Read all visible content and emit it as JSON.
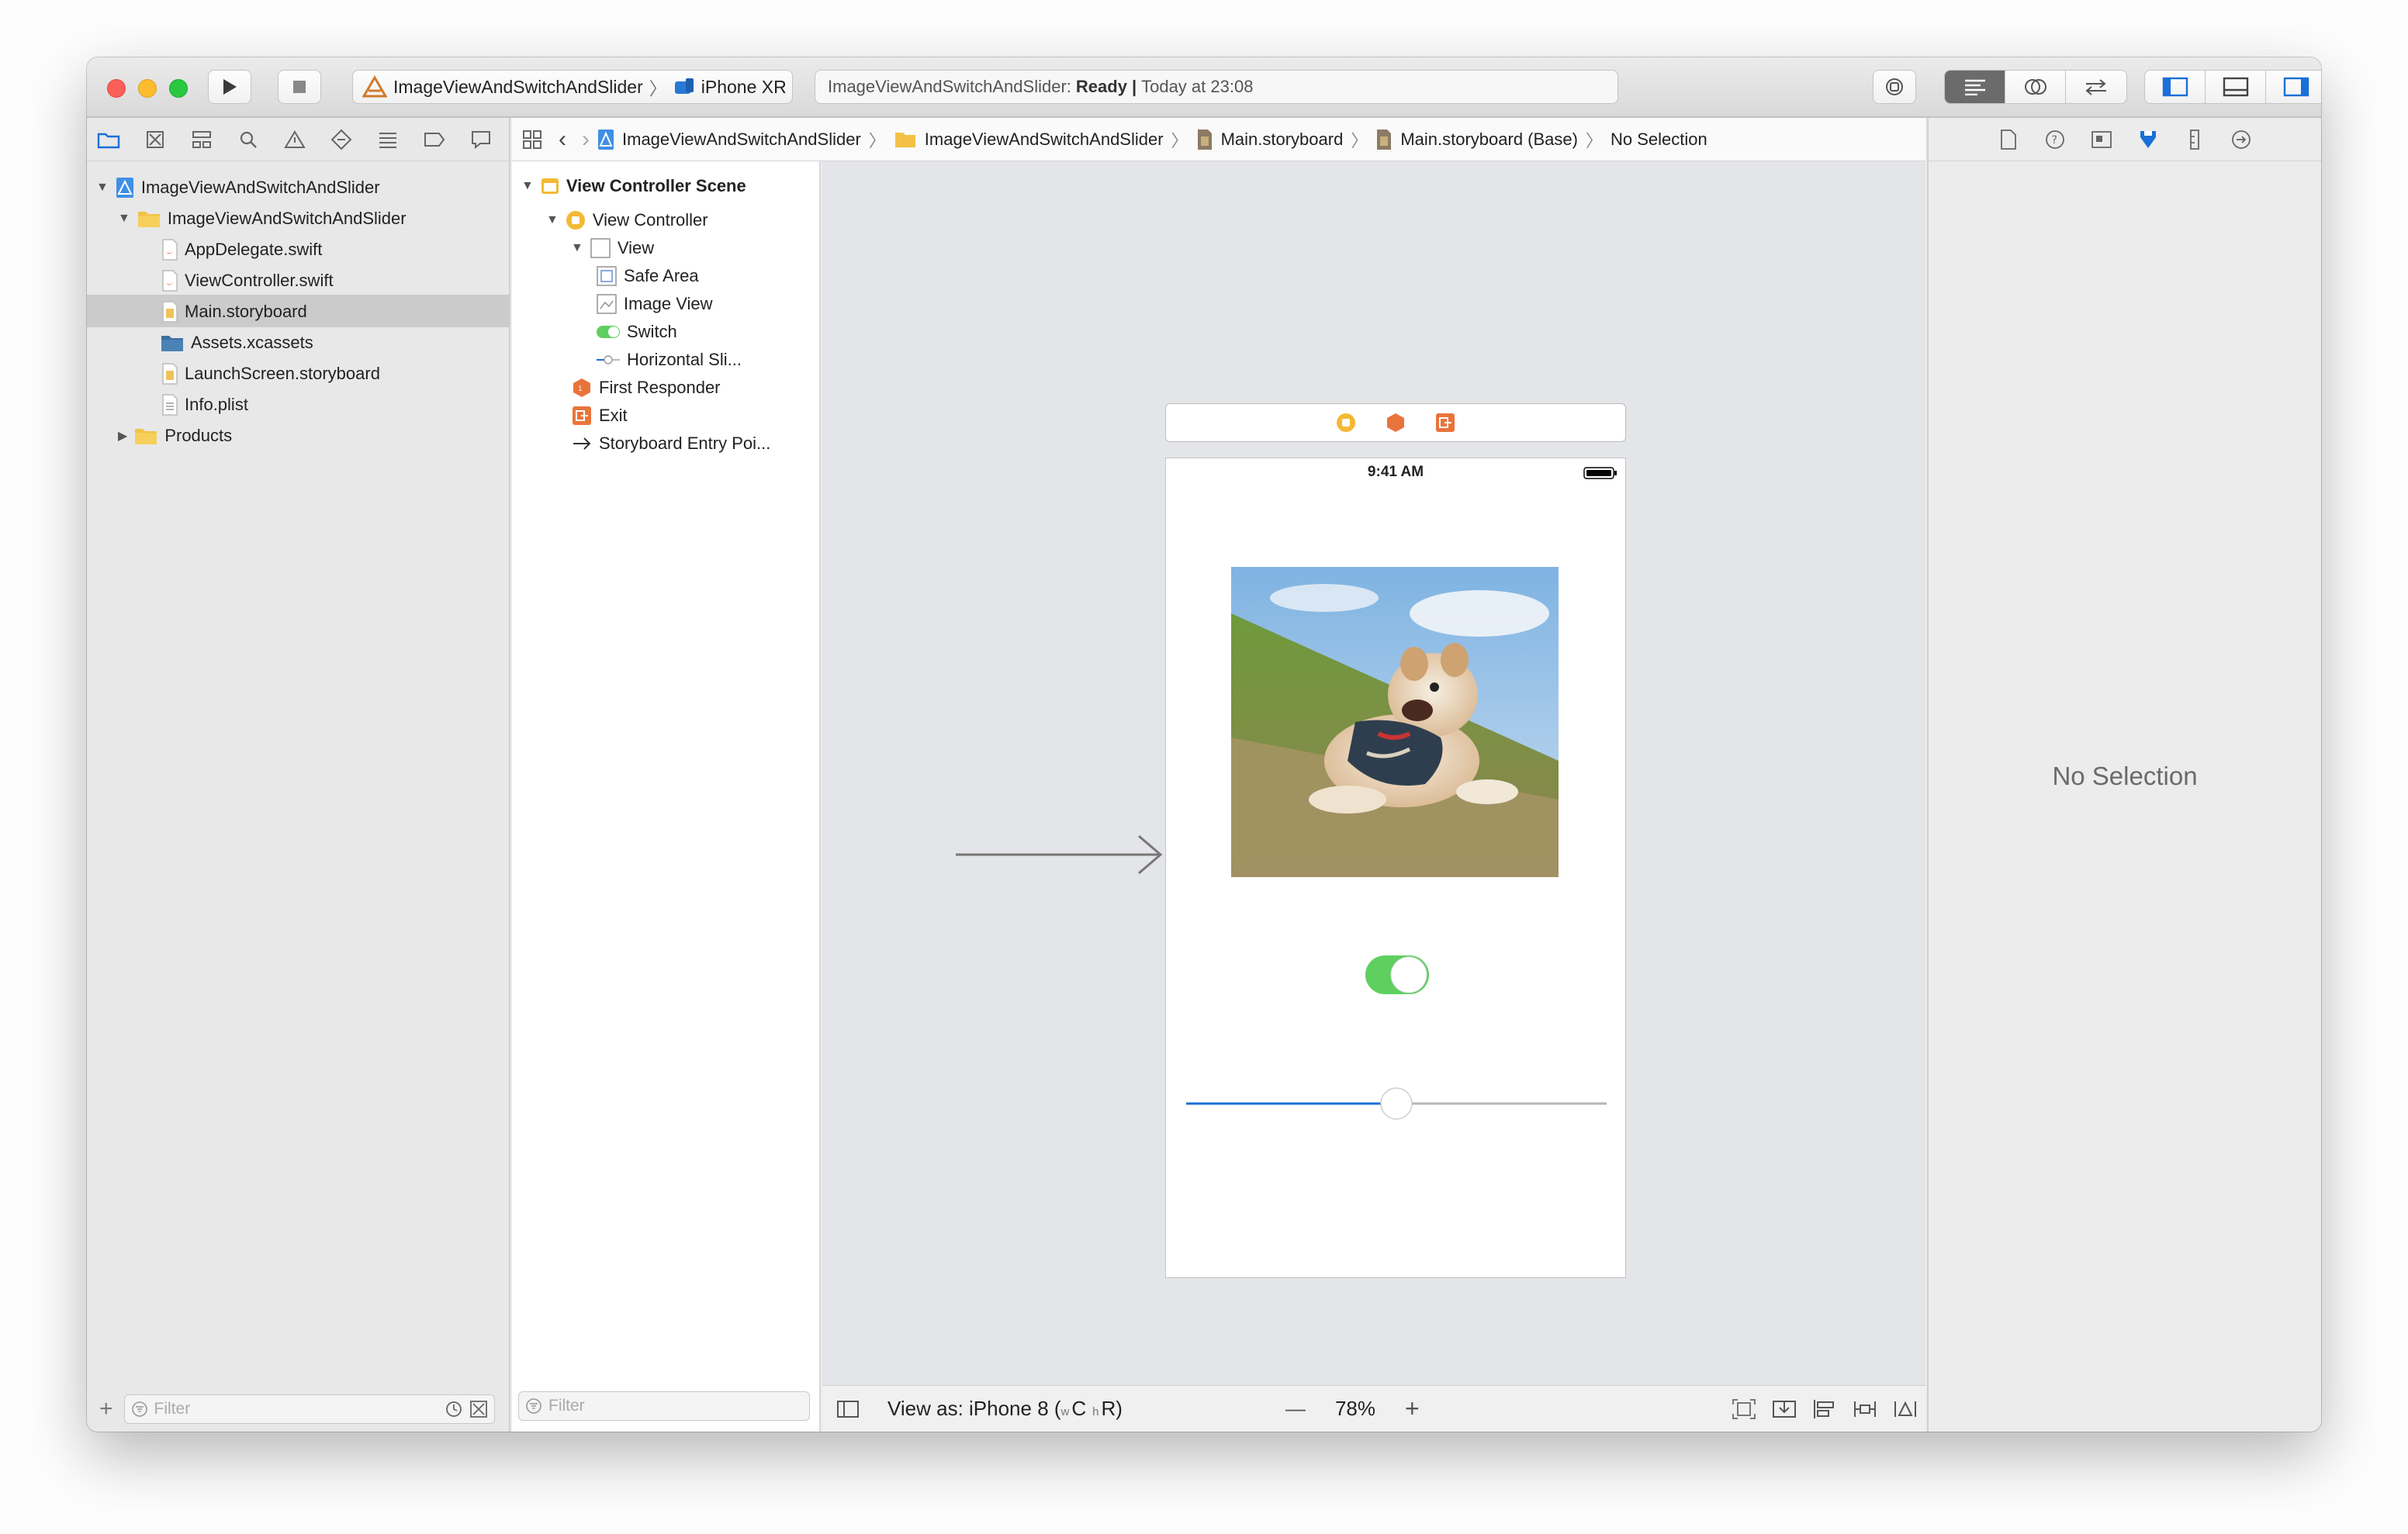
{
  "toolbar": {
    "scheme_name": "ImageViewAndSwitchAndSlider",
    "device_name": "iPhone XR",
    "activity_project": "ImageViewAndSwitchAndSlider:",
    "activity_status": "Ready",
    "activity_separator": "|",
    "activity_time": "Today at 23:08"
  },
  "navigator": {
    "tree": [
      {
        "label": "ImageViewAndSwitchAndSlider",
        "kind": "project"
      },
      {
        "label": "ImageViewAndSwitchAndSlider",
        "kind": "folder"
      },
      {
        "label": "AppDelegate.swift",
        "kind": "swift"
      },
      {
        "label": "ViewController.swift",
        "kind": "swift"
      },
      {
        "label": "Main.storyboard",
        "kind": "storyboard",
        "selected": true
      },
      {
        "label": "Assets.xcassets",
        "kind": "assets"
      },
      {
        "label": "LaunchScreen.storyboard",
        "kind": "storyboard"
      },
      {
        "label": "Info.plist",
        "kind": "plist"
      },
      {
        "label": "Products",
        "kind": "folder"
      }
    ],
    "filter_placeholder": "Filter"
  },
  "jumpbar": {
    "crumbs": [
      "ImageViewAndSwitchAndSlider",
      "ImageViewAndSwitchAndSlider",
      "Main.storyboard",
      "Main.storyboard (Base)",
      "No Selection"
    ]
  },
  "outline": {
    "scene": "View Controller Scene",
    "items": [
      "View Controller",
      "View",
      "Safe Area",
      "Image View",
      "Switch",
      "Horizontal Sli...",
      "First Responder",
      "Exit",
      "Storyboard Entry Poi..."
    ],
    "filter_placeholder": "Filter"
  },
  "device": {
    "status_time": "9:41 AM",
    "switch_on": true,
    "slider_value": 0.5
  },
  "canvas_footer": {
    "view_as_prefix": "View as: iPhone 8 (",
    "size_class_w": "w",
    "size_class_C": "C",
    "size_class_h": "h",
    "size_class_R": "R)",
    "zoom": "78%",
    "zoom_out": "—",
    "zoom_in": "+"
  },
  "inspector": {
    "empty_label": "No Selection"
  },
  "colors": {
    "accent": "#1a6fd8",
    "switch_on": "#5fcf60",
    "selection": "#cbcbcb",
    "storyboard_orange": "#e9743b",
    "vc_yellow": "#f3b934"
  }
}
